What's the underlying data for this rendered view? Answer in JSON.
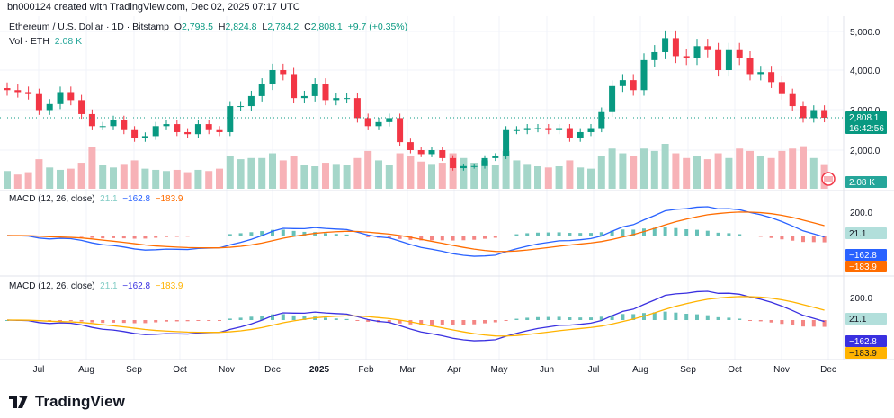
{
  "header": {
    "watermark": "bn000124 created with TradingView.com, Dec 02, 2025 07:17 UTC",
    "symbol": "Ethereum / U.S. Dollar · 1D · Bitstamp",
    "open_label": "O",
    "open": "2,798.5",
    "high_label": "H",
    "high": "2,824.8",
    "low_label": "L",
    "low": "2,784.2",
    "close_label": "C",
    "close": "2,808.1",
    "change": "+9.7 (+0.35%)",
    "vol_label": "Vol · ETH",
    "vol_value": "2.08 K"
  },
  "badges": {
    "price": "2,808.1",
    "countdown": "16:42:56",
    "volume": "2.08 K",
    "hist": "21.1",
    "macd": "−162.8",
    "signal": "−183.9"
  },
  "macd_panels": [
    {
      "label": "MACD (12, 26, close)",
      "hist": "21.1",
      "macd": "−162.8",
      "signal": "−183.9",
      "macd_color": "#2962ff",
      "signal_color": "#ff6d00",
      "axis": "200.0"
    },
    {
      "label": "MACD (12, 26, close)",
      "hist": "21.1",
      "macd": "−162.8",
      "signal": "−183.9",
      "macd_color": "#3a30e0",
      "signal_color": "#ffb300",
      "axis": "200.0"
    }
  ],
  "branding": {
    "logo_text": "TradingView"
  },
  "colors": {
    "up": "#089981",
    "down": "#f23645",
    "up_vol": "#a5d6c9",
    "down_vol": "#f7b2b7",
    "hist_up": "#26a69a",
    "hist_down": "#ef5350"
  },
  "chart_data": {
    "type": "candlestick",
    "interval": "1W approximation of 1D chart",
    "price_axis": {
      "ticks": [
        "2,000.0",
        "3,000.0",
        "4,000.0",
        "5,000.0"
      ],
      "ylim": [
        1300,
        5100
      ]
    },
    "time_axis": {
      "ticks": [
        "Jul",
        "Aug",
        "Sep",
        "Oct",
        "Nov",
        "Dec",
        "2025",
        "Feb",
        "Mar",
        "Apr",
        "May",
        "Jun",
        "Jul",
        "Aug",
        "Sep",
        "Oct",
        "Nov",
        "Dec"
      ]
    },
    "start_week": "2024-06-10",
    "closes": [
      3500,
      3450,
      3400,
      3000,
      3150,
      3450,
      3250,
      2900,
      2600,
      2600,
      2750,
      2500,
      2300,
      2350,
      2600,
      2650,
      2450,
      2400,
      2650,
      2500,
      2450,
      3100,
      3100,
      3350,
      3650,
      4000,
      3900,
      3300,
      3350,
      3650,
      3250,
      3300,
      3300,
      2800,
      2600,
      2700,
      2800,
      2200,
      2000,
      1900,
      2000,
      1800,
      1550,
      1600,
      1600,
      1800,
      1850,
      2500,
      2500,
      2550,
      2550,
      2500,
      2550,
      2300,
      2450,
      2550,
      2950,
      3600,
      3750,
      3500,
      4250,
      4450,
      4800,
      4350,
      4300,
      4600,
      4500,
      4000,
      4500,
      4300,
      3900,
      3950,
      3700,
      3400,
      3100,
      2800,
      3000,
      2808
    ],
    "volume_k": [
      1.5,
      1.2,
      1.4,
      2.5,
      1.8,
      1.6,
      1.7,
      2.2,
      3.5,
      2.0,
      1.8,
      2.1,
      2.4,
      1.7,
      1.6,
      1.5,
      1.6,
      1.4,
      1.6,
      1.5,
      1.7,
      2.8,
      2.5,
      2.6,
      2.6,
      3.0,
      2.4,
      2.8,
      2.0,
      1.9,
      2.2,
      2.1,
      2.0,
      2.6,
      3.2,
      2.4,
      2.0,
      3.0,
      2.8,
      2.3,
      2.1,
      2.2,
      3.0,
      2.6,
      2.2,
      2.4,
      2.0,
      3.2,
      2.4,
      2.1,
      1.9,
      1.8,
      1.9,
      2.4,
      1.8,
      1.7,
      2.8,
      3.4,
      3.0,
      2.8,
      3.4,
      3.2,
      3.8,
      3.0,
      2.6,
      2.8,
      2.5,
      3.0,
      2.6,
      3.4,
      3.2,
      2.8,
      2.6,
      3.2,
      3.4,
      3.6,
      2.6,
      2.08
    ]
  }
}
